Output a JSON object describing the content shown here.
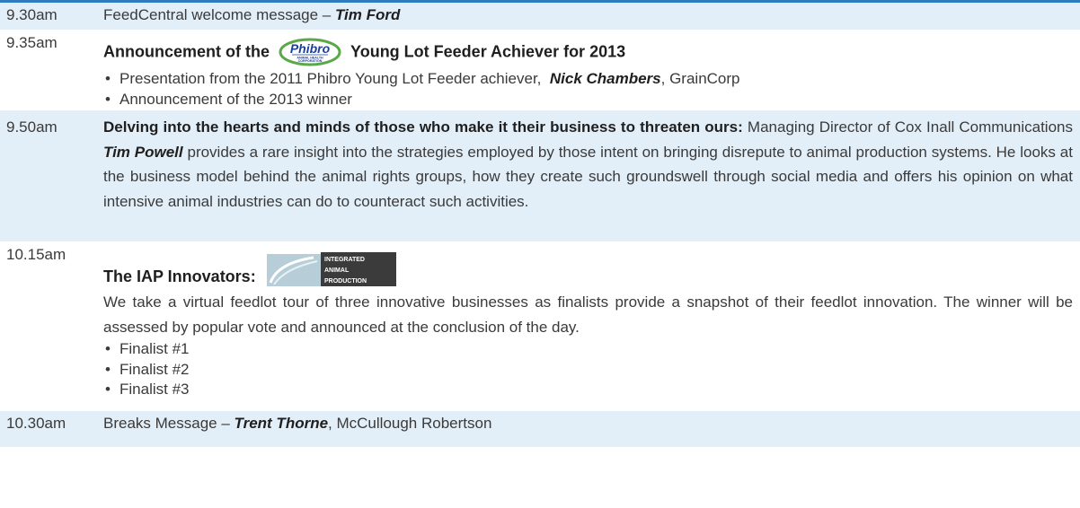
{
  "agenda": {
    "items": [
      {
        "time": "9.30am",
        "text_pre": "FeedCentral welcome message – ",
        "speaker": "Tim Ford"
      },
      {
        "time": "9.35am",
        "title_pre": "Announcement of the",
        "title_post": "Young Lot Feeder Achiever for 2013",
        "logo_main": "Phibro",
        "logo_sub1": "ANIMAL HEALTH",
        "logo_sub2": "CORPORATION",
        "bullets": [
          {
            "text_pre": "Presentation from the 2011 Phibro Young Lot Feeder achiever,",
            "speaker": "Nick Chambers",
            "text_post": ", GrainCorp"
          },
          {
            "text": "Announcement of the 2013 winner"
          }
        ]
      },
      {
        "time": "9.50am",
        "title": "Delving into the hearts and minds of those who make it their business to threaten ours:",
        "text_pre": " Managing Director of Cox Inall Communications ",
        "speaker": "Tim Powell",
        "text_post": " provides a rare insight into the strategies employed by those intent on bringing disrepute to animal production systems. He looks at the business model behind the animal rights groups, how they create such groundswell through social media and offers his opinion on what intensive animal industries can do to counteract such activities."
      },
      {
        "time": "10.15am",
        "title": "The IAP Innovators:",
        "logo_lines": [
          "INTEGRATED",
          "ANIMAL",
          "PRODUCTION"
        ],
        "description": "We take a virtual feedlot tour of three innovative businesses as finalists provide a snapshot of their feedlot innovation.  The winner will be assessed by popular vote and announced at the conclusion of the day.",
        "bullets": [
          "Finalist #1",
          "Finalist #2",
          "Finalist #3"
        ]
      },
      {
        "time": "10.30am",
        "text_pre": "Breaks Message – ",
        "speaker": "Trent Thorne",
        "text_post": ", McCullough Robertson"
      }
    ]
  },
  "colors": {
    "shade": "#e3eff8",
    "rule": "#2f7bbf",
    "phibro_blue": "#1d3f95",
    "phibro_green": "#5aa848"
  }
}
